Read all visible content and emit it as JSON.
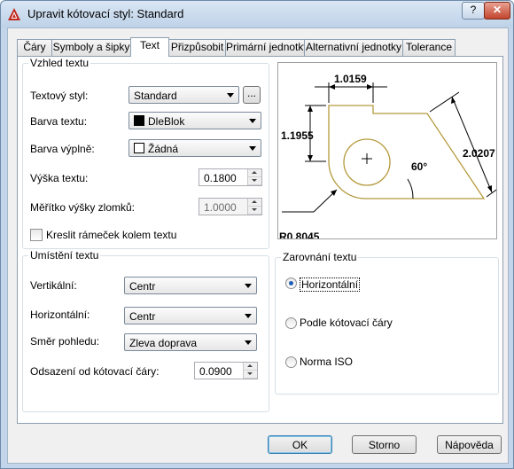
{
  "window": {
    "title": "Upravit kótovací styl: Standard",
    "help_label": "?",
    "close_label": "✕"
  },
  "tabs": [
    {
      "label": "Čáry"
    },
    {
      "label": "Symboly a šipky"
    },
    {
      "label": "Text"
    },
    {
      "label": "Přizpůsobit"
    },
    {
      "label": "Primární jednotky"
    },
    {
      "label": "Alternativní jednotky"
    },
    {
      "label": "Tolerance"
    }
  ],
  "appearance": {
    "title": "Vzhled textu",
    "text_style_label": "Textový styl:",
    "text_style_value": "Standard",
    "browse_label": "...",
    "text_color_label": "Barva textu:",
    "text_color_value": "DleBlok",
    "fill_color_label": "Barva výplně:",
    "fill_color_value": "Žádná",
    "text_height_label": "Výška textu:",
    "text_height_value": "0.1800",
    "fraction_scale_label": "Měřítko výšky zlomků:",
    "fraction_scale_value": "1.0000",
    "frame_label": "Kreslit rámeček kolem textu"
  },
  "placement": {
    "title": "Umístění textu",
    "vertical_label": "Vertikální:",
    "vertical_value": "Centr",
    "horizontal_label": "Horizontální:",
    "horizontal_value": "Centr",
    "view_dir_label": "Směr pohledu:",
    "view_dir_value": "Zleva doprava",
    "offset_label": "Odsazení od kótovací čáry:",
    "offset_value": "0.0900"
  },
  "alignment": {
    "title": "Zarovnání textu",
    "options": [
      {
        "label": "Horizontální",
        "selected": true
      },
      {
        "label": "Podle kótovací čáry",
        "selected": false
      },
      {
        "label": "Norma ISO",
        "selected": false
      }
    ]
  },
  "preview": {
    "dim_top": "1.0159",
    "dim_left": "1.1955",
    "dim_right": "2.0207",
    "dim_angle": "60°",
    "dim_radius": "R0.8045"
  },
  "buttons": {
    "ok": "OK",
    "cancel": "Storno",
    "help": "Nápověda"
  },
  "colors": {
    "accent": "#3c7fb1",
    "preview_part": "#b59a3c"
  }
}
